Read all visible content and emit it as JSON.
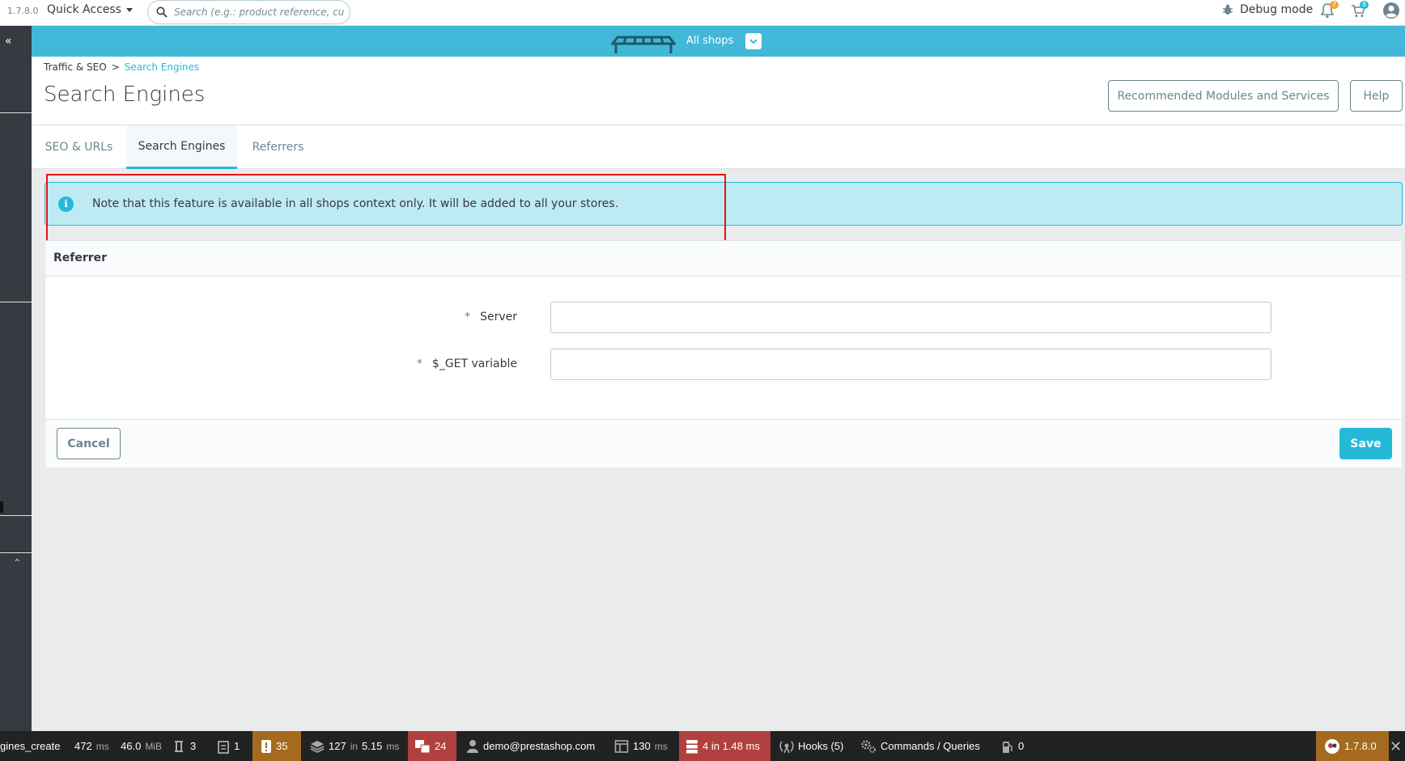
{
  "header": {
    "version": "1.7.8.0",
    "quick_access": "Quick Access",
    "search_placeholder": "Search (e.g.: product reference, custon",
    "debug_mode": "Debug mode",
    "notifications_count": "7",
    "orders_count": "8"
  },
  "shop_bar": {
    "label": "All shops",
    "color": "#42b8d8"
  },
  "breadcrumb": {
    "parent": "Traffic & SEO",
    "separator": ">",
    "current": "Search Engines"
  },
  "page": {
    "title": "Search Engines",
    "recommended_button": "Recommended Modules and Services",
    "help_button": "Help"
  },
  "tabs": [
    {
      "label": "SEO & URLs",
      "active": false
    },
    {
      "label": "Search Engines",
      "active": true
    },
    {
      "label": "Referrers",
      "active": false
    }
  ],
  "alert": {
    "message": "Note that this feature is available in all shops context only. It will be added to all your stores."
  },
  "form": {
    "title": "Referrer",
    "fields": [
      {
        "required_mark": "*",
        "label": "Server",
        "value": ""
      },
      {
        "required_mark": "*",
        "label": "$_GET variable",
        "value": ""
      }
    ],
    "cancel": "Cancel",
    "save": "Save",
    "accent_color": "#25b9d7"
  },
  "debug_toolbar": {
    "route": "gines_create",
    "time": "472",
    "time_unit": "ms",
    "memory": "46.0",
    "memory_unit": "MiB",
    "forms": "3",
    "logs": "1",
    "warnings": "35",
    "cache_count": "127",
    "cache_in": "in",
    "cache_time": "5.15",
    "cache_unit": "ms",
    "translations": "24",
    "user": "demo@prestashop.com",
    "render_time": "130",
    "render_unit": "ms",
    "db_queries": "4 in 1.48 ms",
    "hooks": "Hooks (5)",
    "commands": "Commands / Queries",
    "modules": "0",
    "ps_version": "1.7.8.0"
  }
}
